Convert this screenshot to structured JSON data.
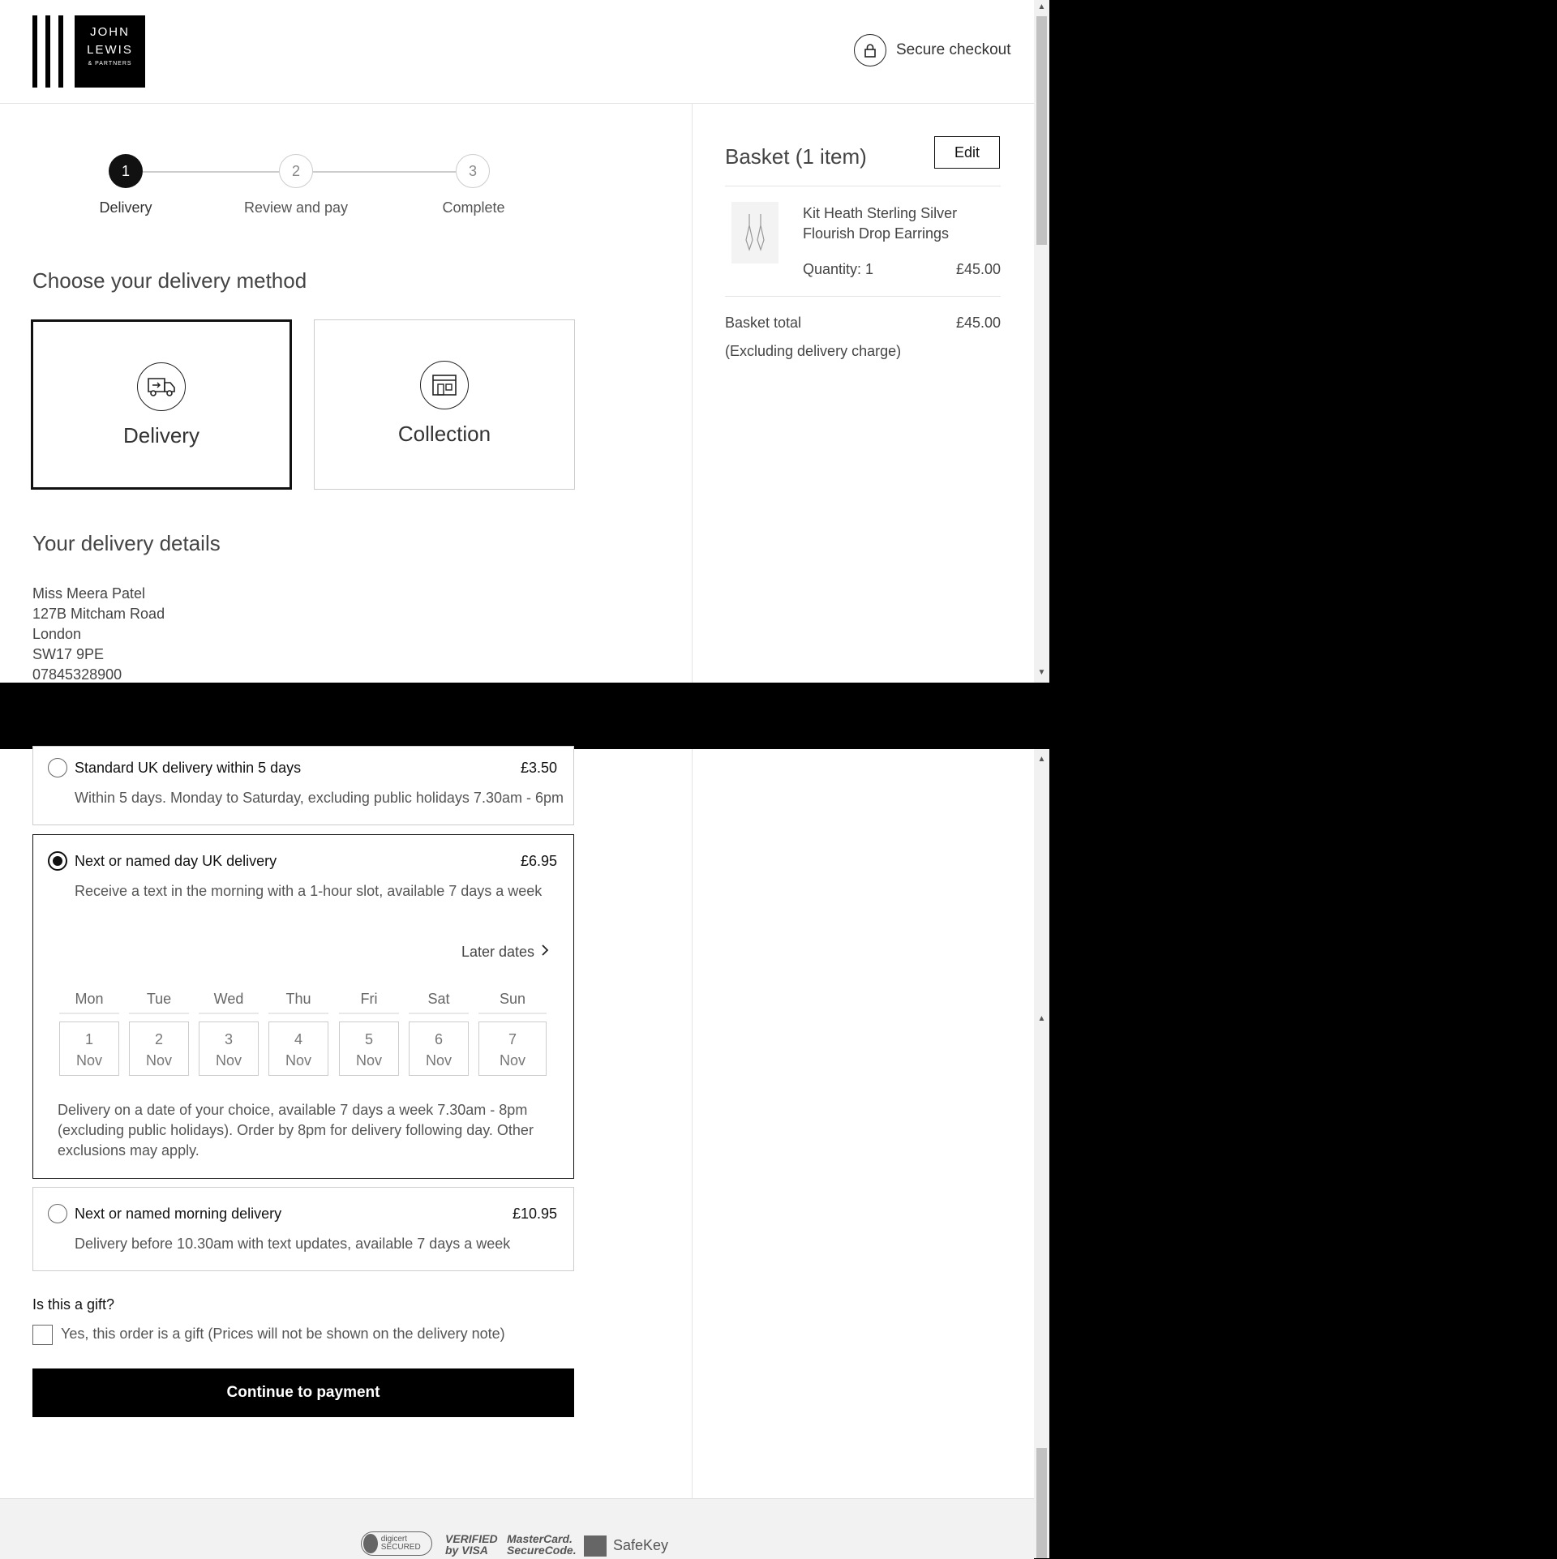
{
  "header": {
    "logo_line1": "JOHN",
    "logo_line2": "LEWIS",
    "logo_line3": "& PARTNERS",
    "secure_label": "Secure checkout"
  },
  "steps": [
    {
      "number": "1",
      "label": "Delivery",
      "state": "active"
    },
    {
      "number": "2",
      "label": "Review and pay",
      "state": "inactive"
    },
    {
      "number": "3",
      "label": "Complete",
      "state": "inactive"
    }
  ],
  "delivery_method": {
    "heading": "Choose your delivery method",
    "options": [
      {
        "label": "Delivery",
        "icon": "delivery-van-icon",
        "selected": true
      },
      {
        "label": "Collection",
        "icon": "store-icon",
        "selected": false
      }
    ]
  },
  "delivery_details": {
    "heading": "Your delivery details",
    "name": "Miss Meera Patel",
    "street": "127B Mitcham Road",
    "city": "London",
    "postcode": "SW17 9PE",
    "phone": "07845328900"
  },
  "basket": {
    "title": "Basket (1 item)",
    "edit_label": "Edit",
    "item": {
      "name_line1": "Kit Heath Sterling Silver",
      "name_line2": "Flourish Drop Earrings",
      "quantity": "Quantity: 1",
      "price": "£45.00"
    },
    "total_label": "Basket total",
    "total_value": "£45.00",
    "total_note": "(Excluding delivery charge)"
  },
  "delivery_options": [
    {
      "title": "Standard UK delivery within 5 days",
      "price": "£3.50",
      "desc": "Within 5 days. Monday to Saturday, excluding public holidays 7.30am - 6pm",
      "selected": false
    },
    {
      "title": "Next or named day UK delivery",
      "price": "£6.95",
      "desc": "Receive a text in the morning with a 1-hour slot, available 7 days a week",
      "selected": true
    },
    {
      "title": "Next or named morning delivery",
      "price": "£10.95",
      "desc": "Delivery before 10.30am with text updates, available 7 days a week",
      "selected": false
    }
  ],
  "calendar": {
    "later_dates": "Later dates",
    "days": [
      {
        "name": "Mon",
        "date": "1",
        "month": "Nov"
      },
      {
        "name": "Tue",
        "date": "2",
        "month": "Nov"
      },
      {
        "name": "Wed",
        "date": "3",
        "month": "Nov"
      },
      {
        "name": "Thu",
        "date": "4",
        "month": "Nov"
      },
      {
        "name": "Fri",
        "date": "5",
        "month": "Nov"
      },
      {
        "name": "Sat",
        "date": "6",
        "month": "Nov"
      },
      {
        "name": "Sun",
        "date": "7",
        "month": "Nov"
      }
    ],
    "note_line1": "Delivery on a date of your choice, available 7 days a week 7.30am - 8pm",
    "note_line2": "(excluding public holidays). Order by 8pm for delivery following day. Other",
    "note_line3": "exclusions may apply."
  },
  "gift": {
    "heading": "Is this a gift?",
    "checkbox_label": "Yes, this order is a gift (Prices will not be shown on the delivery note)",
    "checked": false
  },
  "cta_label": "Continue to payment",
  "footer_badges": {
    "digicert": "digicert SECURED",
    "visa": "VERIFIED by VISA",
    "mastercard": "MasterCard. SecureCode.",
    "safekey": "SafeKey"
  }
}
